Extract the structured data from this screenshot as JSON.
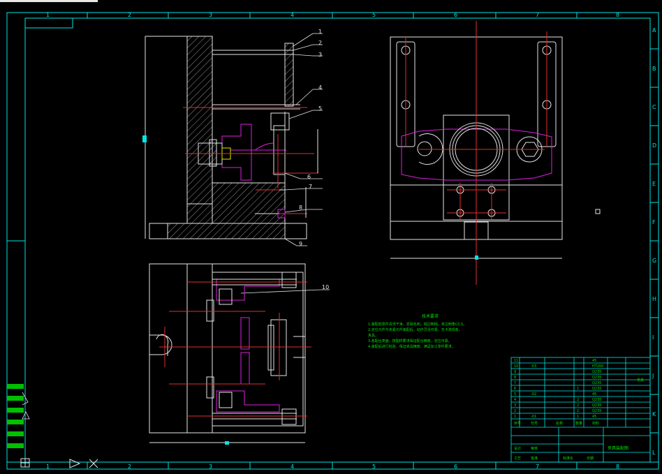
{
  "frame": {
    "column_labels": [
      "1",
      "2",
      "3",
      "4",
      "5",
      "6",
      "7",
      "8"
    ],
    "row_labels": [
      "A",
      "B",
      "C",
      "D",
      "E",
      "F",
      "G",
      "H",
      "I",
      "J",
      "K",
      "L"
    ]
  },
  "callouts": [
    "1",
    "2",
    "3",
    "4",
    "5",
    "6",
    "7",
    "8",
    "9",
    "10"
  ],
  "notes": {
    "title": "技术要求",
    "lines": [
      "1.装配前零件清洗干净，去除毛刺，锐边倒钝，未注倒角C0.5。",
      "2.定位元件与夹紧元件装配后，动作灵活可靠，无卡滞现象。",
      "夹具。",
      "3.各配合表面，按图样要求保证配合精度，定位可靠。",
      "4.装配后进行检验，保证夹具精度，满足加工零件要求。"
    ]
  },
  "bom": {
    "rows": [
      {
        "no": "11",
        "code": "",
        "name": "",
        "qty": "",
        "mat": "45"
      },
      {
        "no": "10",
        "code": "-03",
        "name": "",
        "qty": "",
        "mat": "HT200"
      },
      {
        "no": "9",
        "code": "",
        "name": "",
        "qty": "",
        "mat": "Q235"
      },
      {
        "no": "8",
        "code": "",
        "name": "",
        "qty": "",
        "mat": "Q235"
      },
      {
        "no": "7",
        "code": "",
        "name": "",
        "qty": "",
        "mat": "Q235"
      },
      {
        "no": "6",
        "code": "",
        "name": "",
        "qty": "1",
        "mat": "Q235"
      },
      {
        "no": "5",
        "code": "-02",
        "name": "",
        "qty": "",
        "mat": "45"
      },
      {
        "no": "4",
        "code": "",
        "name": "",
        "qty": "2",
        "mat": "Q235"
      },
      {
        "no": "3",
        "code": "",
        "name": "",
        "qty": "2",
        "mat": "Q235"
      },
      {
        "no": "2",
        "code": "",
        "name": "",
        "qty": "2",
        "mat": "Q235"
      },
      {
        "no": "1",
        "code": "-01",
        "name": "",
        "qty": "1",
        "mat": "45"
      }
    ],
    "header": [
      "序号",
      "代号",
      "名称",
      "数量",
      "材料"
    ],
    "side_text": "夹具"
  },
  "title_block": {
    "drawing_name": "夹具装配图",
    "labels": [
      "设计",
      "审核",
      "工艺",
      "批准",
      "标准化",
      "日期"
    ]
  },
  "layer_panel": {
    "items": [
      "",
      "",
      "",
      "",
      "",
      ""
    ]
  },
  "colors": {
    "frame": "#00e5e5",
    "geometry": "#e6e6e6",
    "center_lines": "#e03030",
    "workpiece": "#e020e0",
    "notes": "#00e000"
  }
}
